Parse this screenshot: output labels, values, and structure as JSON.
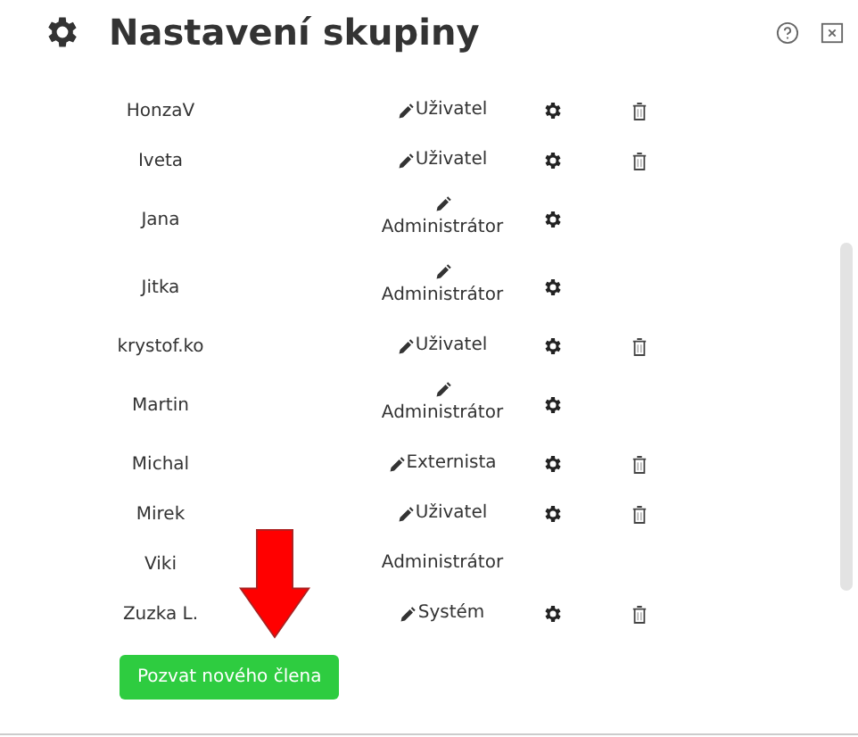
{
  "header": {
    "title": "Nastavení skupiny"
  },
  "members": [
    {
      "name": "HonzaV",
      "role": "Uživatel",
      "editable": true,
      "settings": true,
      "deletable": true
    },
    {
      "name": "Iveta",
      "role": "Uživatel",
      "editable": true,
      "settings": true,
      "deletable": true
    },
    {
      "name": "Jana",
      "role": "Administrátor",
      "editable": true,
      "settings": true,
      "deletable": false
    },
    {
      "name": "Jitka",
      "role": "Administrátor",
      "editable": true,
      "settings": true,
      "deletable": false
    },
    {
      "name": "krystof.ko",
      "role": "Uživatel",
      "editable": true,
      "settings": true,
      "deletable": true
    },
    {
      "name": "Martin",
      "role": "Administrátor",
      "editable": true,
      "settings": true,
      "deletable": false
    },
    {
      "name": "Michal",
      "role": "Externista",
      "editable": true,
      "settings": true,
      "deletable": true
    },
    {
      "name": "Mirek",
      "role": "Uživatel",
      "editable": true,
      "settings": true,
      "deletable": true
    },
    {
      "name": "Viki",
      "role": "Administrátor",
      "editable": false,
      "settings": false,
      "deletable": false
    },
    {
      "name": "Zuzka L.",
      "role": "Systém",
      "editable": true,
      "settings": true,
      "deletable": true
    }
  ],
  "invite_button": "Pozvat nového člena"
}
